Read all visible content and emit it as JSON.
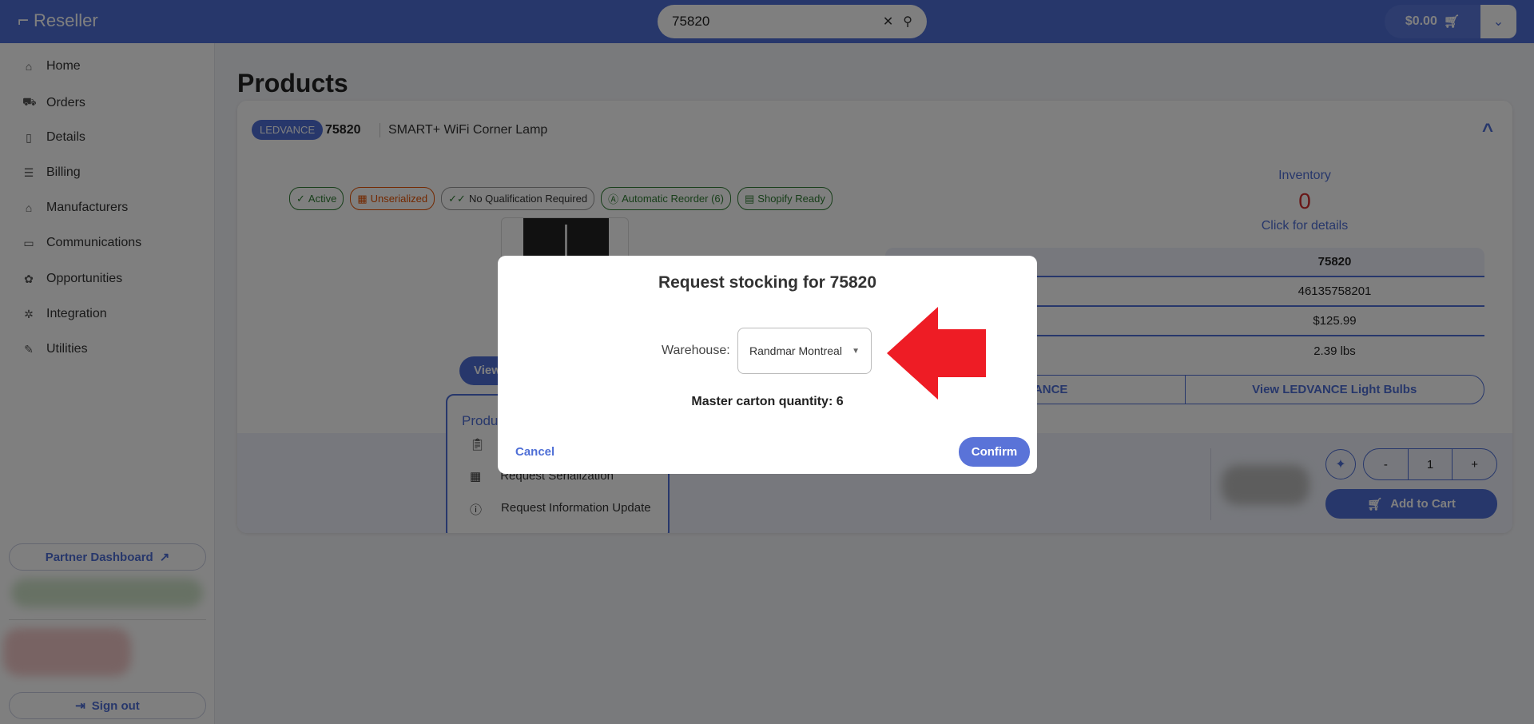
{
  "header": {
    "app_name": "Reseller",
    "search_value": "75820",
    "cart_total": "$0.00"
  },
  "sidebar": {
    "items": [
      {
        "label": "Home",
        "icon": "home-icon"
      },
      {
        "label": "Orders",
        "icon": "truck-icon"
      },
      {
        "label": "Details",
        "icon": "document-icon"
      },
      {
        "label": "Billing",
        "icon": "billing-icon"
      },
      {
        "label": "Manufacturers",
        "icon": "factory-icon"
      },
      {
        "label": "Communications",
        "icon": "chat-icon"
      },
      {
        "label": "Opportunities",
        "icon": "opportunity-icon"
      },
      {
        "label": "Integration",
        "icon": "plug-icon"
      },
      {
        "label": "Utilities",
        "icon": "wrench-icon"
      }
    ],
    "partner_dashboard": "Partner Dashboard",
    "sign_out": "Sign out"
  },
  "page": {
    "title": "Products"
  },
  "product": {
    "brand": "LEDVANCE",
    "sku": "75820",
    "name": "SMART+ WiFi Corner Lamp",
    "badges": [
      {
        "label": "Active",
        "color": "#2e7d32"
      },
      {
        "label": "Unserialized",
        "color": "#e65100"
      },
      {
        "label": "No Qualification Required",
        "color": "#333333"
      },
      {
        "label": "Automatic Reorder (6)",
        "color": "#2e7d32"
      },
      {
        "label": "Shopify Ready",
        "color": "#2e7d32"
      }
    ],
    "inventory_label": "Inventory",
    "inventory_value": "0",
    "inventory_link": "Click for details",
    "table": {
      "header": "75820",
      "rows": [
        "46135758201",
        "$125.99",
        "2.39 lbs"
      ]
    },
    "links": [
      "LEDVANCE",
      "View LEDVANCE Light Bulbs"
    ],
    "view_button": "View",
    "menu": {
      "title": "Produ",
      "items": [
        "Request Serialization",
        "Request Information Update"
      ]
    },
    "quantity": "1",
    "minus": "-",
    "plus": "+",
    "add_to_cart": "Add to Cart"
  },
  "modal": {
    "title": "Request stocking for 75820",
    "warehouse_label": "Warehouse:",
    "warehouse_value": "Randmar Montreal",
    "master_carton": "Master carton quantity: 6",
    "cancel": "Cancel",
    "confirm": "Confirm"
  },
  "colors": {
    "accent": "#4f6fd6",
    "arrow": "#ee1c25",
    "inventory_zero": "#d32f2f"
  }
}
